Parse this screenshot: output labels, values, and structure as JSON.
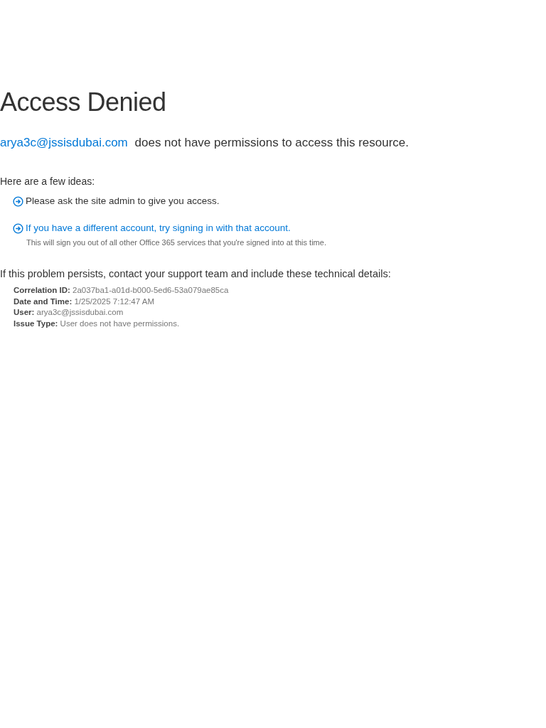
{
  "title": "Access Denied",
  "message": {
    "account": "arya3c@jssisdubai.com",
    "text": "does not have permissions to access this resource."
  },
  "ideas_heading": "Here are a few ideas:",
  "ideas": [
    {
      "kind": "text",
      "text": "Please ask the site admin to give you access."
    },
    {
      "kind": "link",
      "text": "If you have a different account, try signing in with that account.",
      "note": "This will sign you out of all other Office 365 services that you're signed into at this time."
    }
  ],
  "details_heading": "If this problem persists, contact your support team and include these technical details:",
  "details": [
    {
      "label": "Correlation ID:",
      "value": "2a037ba1-a01d-b000-5ed6-53a079ae85ca"
    },
    {
      "label": "Date and Time:",
      "value": "1/25/2025 7:12:47 AM"
    },
    {
      "label": "User:",
      "value": "arya3c@jssisdubai.com"
    },
    {
      "label": "Issue Type:",
      "value": "User does not have permissions."
    }
  ]
}
